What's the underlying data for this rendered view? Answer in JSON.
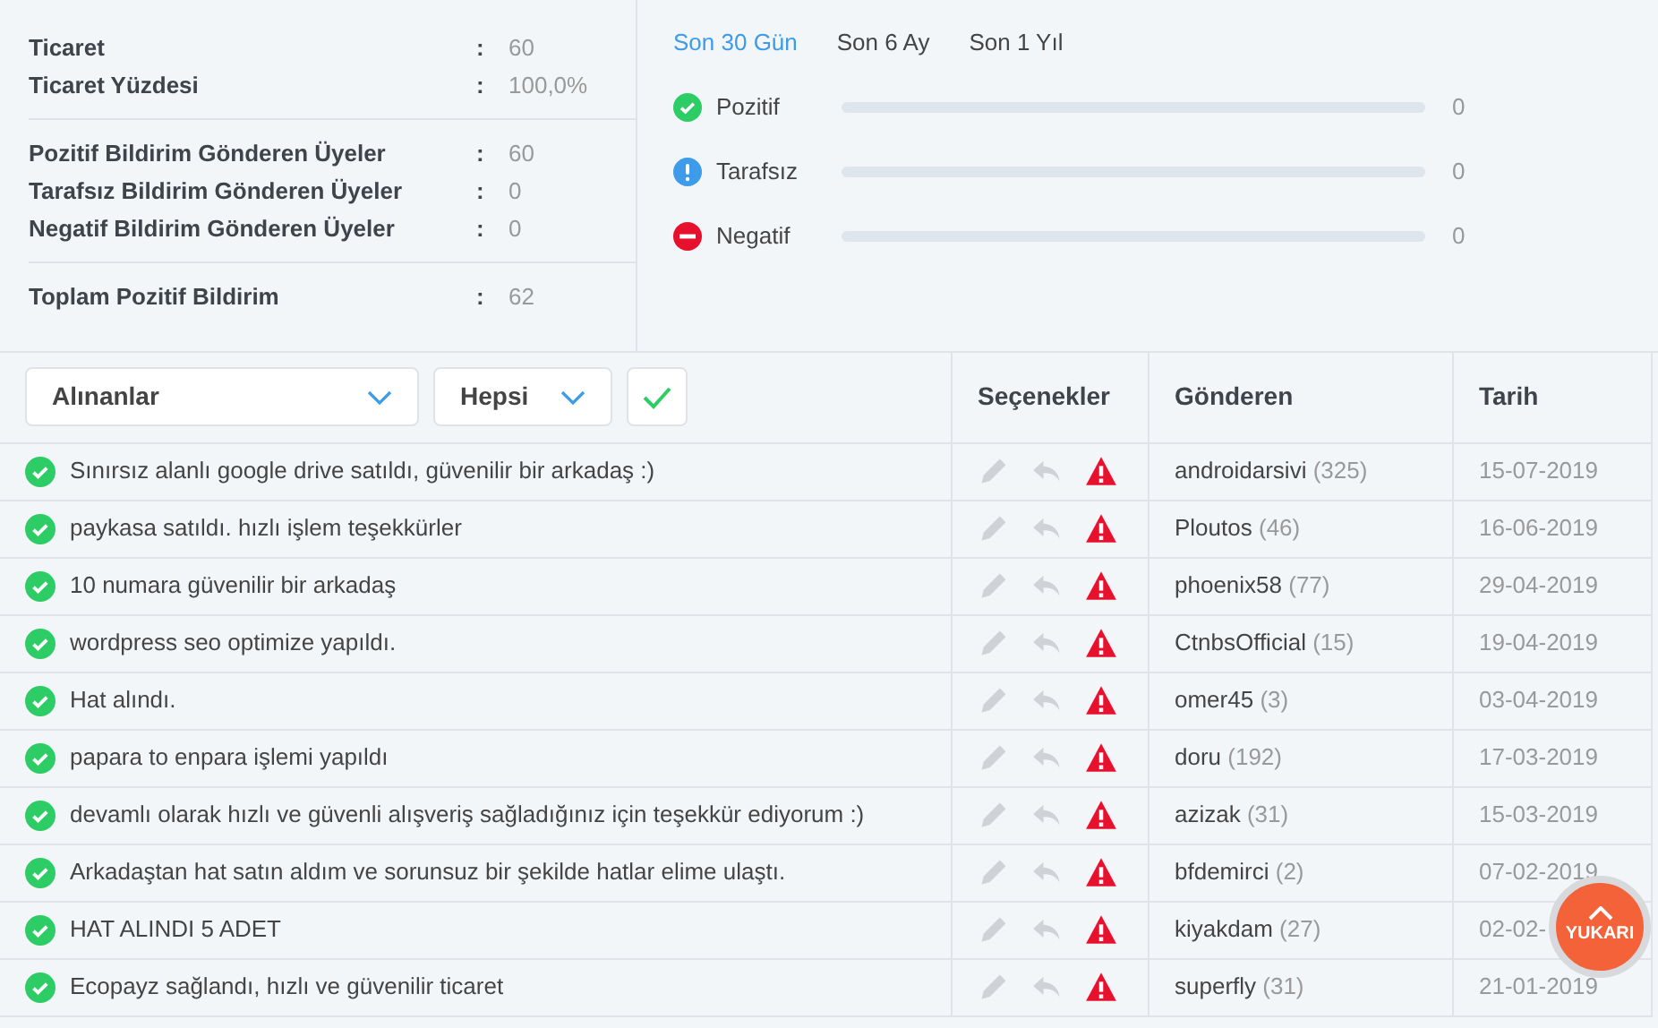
{
  "stats": [
    {
      "items": [
        {
          "label": "Ticaret",
          "value": "60"
        },
        {
          "label": "Ticaret Yüzdesi",
          "value": "100,0%"
        }
      ]
    },
    {
      "items": [
        {
          "label": "Pozitif Bildirim Gönderen Üyeler",
          "value": "60"
        },
        {
          "label": "Tarafsız Bildirim Gönderen Üyeler",
          "value": "0"
        },
        {
          "label": "Negatif Bildirim Gönderen Üyeler",
          "value": "0"
        }
      ]
    },
    {
      "items": [
        {
          "label": "Toplam Pozitif Bildirim",
          "value": "62"
        }
      ]
    }
  ],
  "separator": ":",
  "periods": [
    {
      "label": "Son 30 Gün",
      "selected": true
    },
    {
      "label": "Son 6 Ay",
      "selected": false
    },
    {
      "label": "Son 1 Yıl",
      "selected": false
    }
  ],
  "breakdown": [
    {
      "kind": "positive",
      "label": "Pozitif",
      "level": 0,
      "count": "0"
    },
    {
      "kind": "neutral",
      "label": "Tarafsız",
      "level": 0,
      "count": "0"
    },
    {
      "kind": "negative",
      "label": "Negatif",
      "level": 0,
      "count": "0"
    }
  ],
  "filters": {
    "direction": "Alınanlar",
    "type": "Hepsi"
  },
  "table": {
    "columns": [
      "Seçenekler",
      "Gönderen",
      "Tarih"
    ],
    "rows": [
      {
        "kind": "positive",
        "comment": "Sınırsız alanlı google drive satıldı, güvenilir bir arkadaş :)",
        "sender": "androidarsivi",
        "score": "(325)",
        "date": "15-07-2019"
      },
      {
        "kind": "positive",
        "comment": "paykasa satıldı. hızlı işlem teşekkürler",
        "sender": "Ploutos",
        "score": "(46)",
        "date": "16-06-2019"
      },
      {
        "kind": "positive",
        "comment": "10 numara güvenilir bir arkadaş",
        "sender": "phoenix58",
        "score": "(77)",
        "date": "29-04-2019"
      },
      {
        "kind": "positive",
        "comment": "wordpress seo optimize yapıldı.",
        "sender": "CtnbsOfficial",
        "score": "(15)",
        "date": "19-04-2019"
      },
      {
        "kind": "positive",
        "comment": "Hat alındı.",
        "sender": "omer45",
        "score": "(3)",
        "date": "03-04-2019"
      },
      {
        "kind": "positive",
        "comment": "papara to enpara işlemi yapıldı",
        "sender": "doru",
        "score": "(192)",
        "date": "17-03-2019"
      },
      {
        "kind": "positive",
        "comment": "devamlı olarak hızlı ve güvenli alışveriş sağladığınız için teşekkür ediyorum :)",
        "sender": "azizak",
        "score": "(31)",
        "date": "15-03-2019"
      },
      {
        "kind": "positive",
        "comment": "Arkadaştan hat satın aldım ve sorunsuz bir şekilde hatlar elime ulaştı.",
        "sender": "bfdemirci",
        "score": "(2)",
        "date": "07-02-2019"
      },
      {
        "kind": "positive",
        "comment": "HAT ALINDI 5 ADET",
        "sender": "kiyakdam",
        "score": "(27)",
        "date": "02-02-"
      },
      {
        "kind": "positive",
        "comment": "Ecopayz sağlandı, hızlı ve güvenilir ticaret",
        "sender": "superfly",
        "score": "(31)",
        "date": "21-01-2019"
      }
    ]
  },
  "scroll_top": {
    "label": "YUKARI"
  }
}
